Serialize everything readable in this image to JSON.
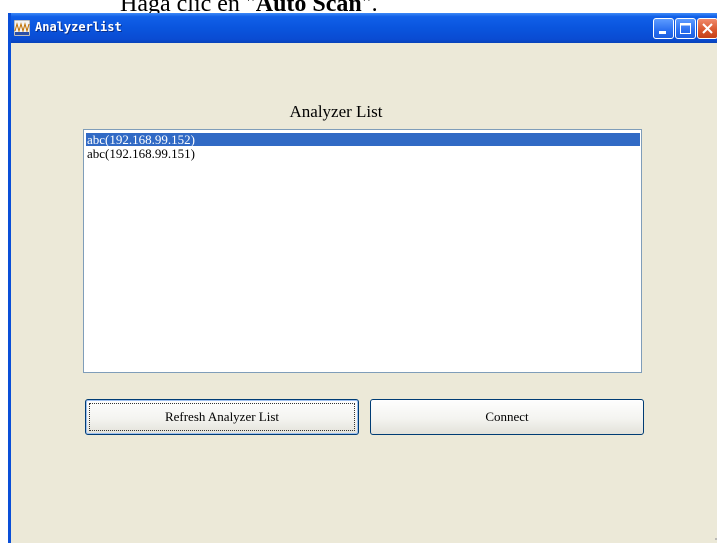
{
  "document": {
    "text_prefix": "Haga clic en \"",
    "text_bold": "Auto Scan",
    "text_suffix": "\"."
  },
  "window": {
    "title": "Analyzerlist",
    "icon": "analyzer-app-icon",
    "controls": [
      "minimize-icon",
      "maximize-icon",
      "close-icon"
    ]
  },
  "main": {
    "list_label": "Analyzer List",
    "items": [
      {
        "label": "abc(192.168.99.152)",
        "selected": true
      },
      {
        "label": "abc(192.168.99.151)",
        "selected": false
      }
    ],
    "refresh_button_label": "Refresh Analyzer List",
    "connect_button_label": "Connect"
  },
  "colors": {
    "titlebar": "#0a55de",
    "window_background": "#ece9d8",
    "selection": "#316ac5"
  }
}
